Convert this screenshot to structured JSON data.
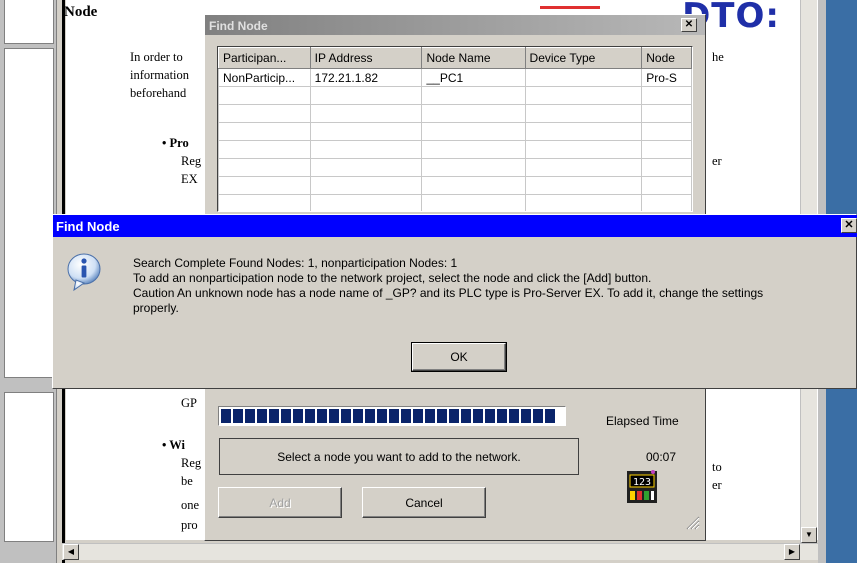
{
  "help": {
    "title": "Node",
    "brand": "DTO:",
    "lines": {
      "intro1": "In order to",
      "intro1_tail": "he",
      "intro2": "information",
      "intro3": "beforehand",
      "bullet1_title": "Pro",
      "bullet1_l1": "Reg",
      "bullet1_l1_tail": "er",
      "bullet1_l2": "EX",
      "frag_gp": "GP",
      "bullet2_title": "Wi",
      "bullet2_l1": "Reg",
      "bullet2_l1_tail": "to",
      "bullet2_l2": "be",
      "bullet2_l2_tail": "er",
      "bullet2_l3": "one",
      "bullet2_l4": "pro"
    }
  },
  "find_node_dialog": {
    "title": "Find Node",
    "close_glyph": "✕",
    "columns": [
      "Participan...",
      "IP Address",
      "Node Name",
      "Device Type",
      "Node"
    ],
    "rows": [
      [
        "NonParticip...",
        "172.21.1.82",
        "__PC1",
        "",
        "Pro-S"
      ]
    ],
    "progress_fraction": 1.0,
    "elapsed_label": "Elapsed Time",
    "elapsed_value": "00:07",
    "status_message": "Select a node you want to add to the network.",
    "add_label": "Add",
    "cancel_label": "Cancel"
  },
  "message_box": {
    "title": "Find Node",
    "close_glyph": "✕",
    "icon": "info-icon",
    "line1": "Search Complete Found Nodes: 1, nonparticipation Nodes: 1",
    "line2": "To add an nonparticipation node to the network project, select the node and click the [Add] button.",
    "line3": "Caution An unknown node has a node name of _GP? and its PLC type is Pro-Server EX. To add it, change the settings",
    "line4": "properly.",
    "ok_label": "OK"
  }
}
